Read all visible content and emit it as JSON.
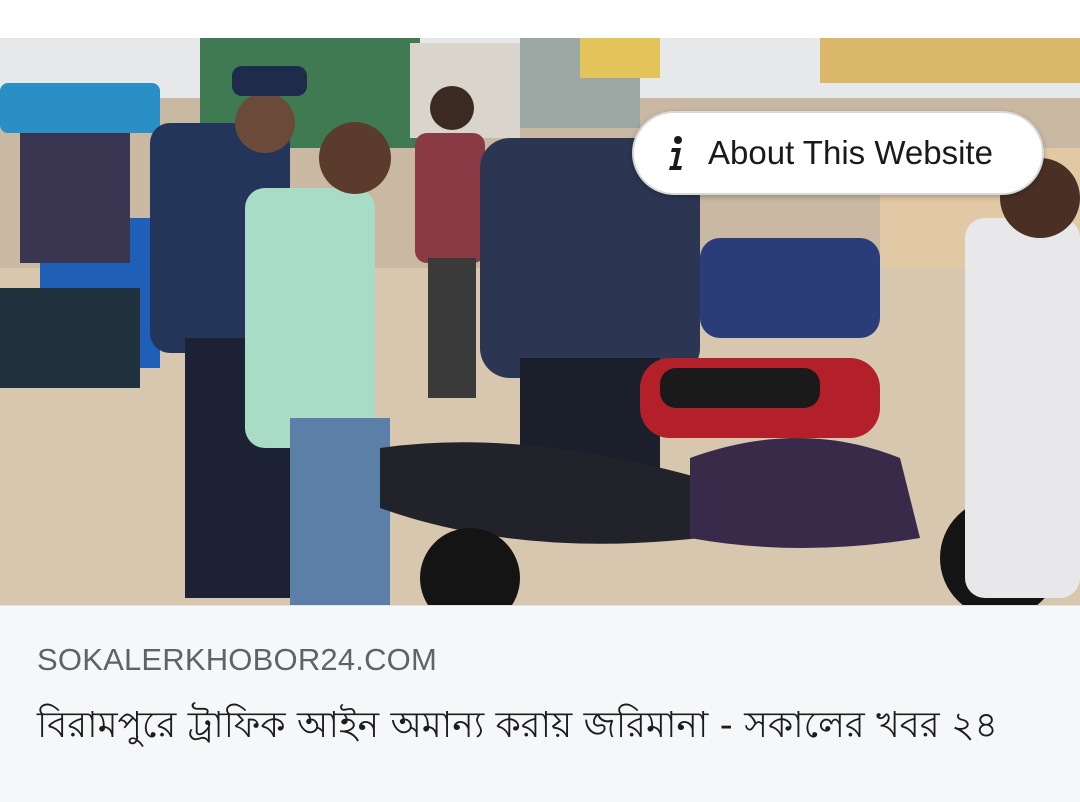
{
  "preview": {
    "about_label": "About This Website",
    "about_icon": "info-icon",
    "photo_subject": "traffic police checking motorcycles on a street"
  },
  "card": {
    "domain": "SOKALERKHOBOR24.COM",
    "title": "বিরামপুরে ট্রাফিক আইন অমান্য করায় জরিমানা - সকালের খবর ২৪"
  },
  "colors": {
    "card_background": "#f6f7f9",
    "domain_text": "#5f6368",
    "title_text": "#1c1c1c"
  }
}
